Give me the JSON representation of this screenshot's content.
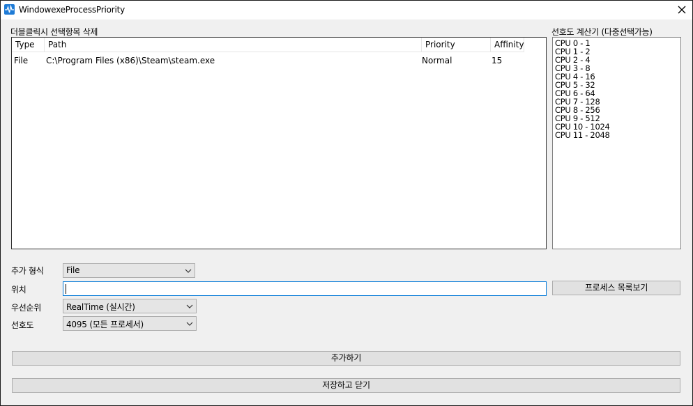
{
  "window": {
    "title": "WindowexeProcessPriority",
    "close_glyph": "✕"
  },
  "process_list": {
    "label": "더블클릭시 선택항목 삭제",
    "columns": [
      "Type",
      "Path",
      "Priority",
      "Affinity"
    ],
    "rows": [
      {
        "type": "File",
        "path": "C:\\Program Files (x86)\\Steam\\steam.exe",
        "priority": "Normal",
        "affinity": "15"
      }
    ]
  },
  "affinity_calculator": {
    "label": "선호도 계산기 (다중선택가능)",
    "items": [
      "CPU 0 - 1",
      "CPU 1 - 2",
      "CPU 2 - 4",
      "CPU 3 - 8",
      "CPU 4 - 16",
      "CPU 5 - 32",
      "CPU 6 - 64",
      "CPU 7 - 128",
      "CPU 8 - 256",
      "CPU 9 - 512",
      "CPU 10 - 1024",
      "CPU 11 - 2048"
    ]
  },
  "form": {
    "add_type_label": "추가 형식",
    "add_type_value": "File",
    "location_label": "위치",
    "location_value": "",
    "priority_label": "우선순위",
    "priority_value": "RealTime (실시간)",
    "affinity_label": "선호도",
    "affinity_value": "4095 (모든 프로세서)",
    "process_list_button": "프로세스 목록보기"
  },
  "actions": {
    "add_button": "추가하기",
    "save_close_button": "저장하고 닫기"
  },
  "icons": {
    "app": "pulse-icon",
    "close": "close-icon",
    "dropdown": "chevron-down-icon"
  },
  "colors": {
    "app_icon": "#1e7bd6",
    "focus_border": "#0078d7"
  }
}
